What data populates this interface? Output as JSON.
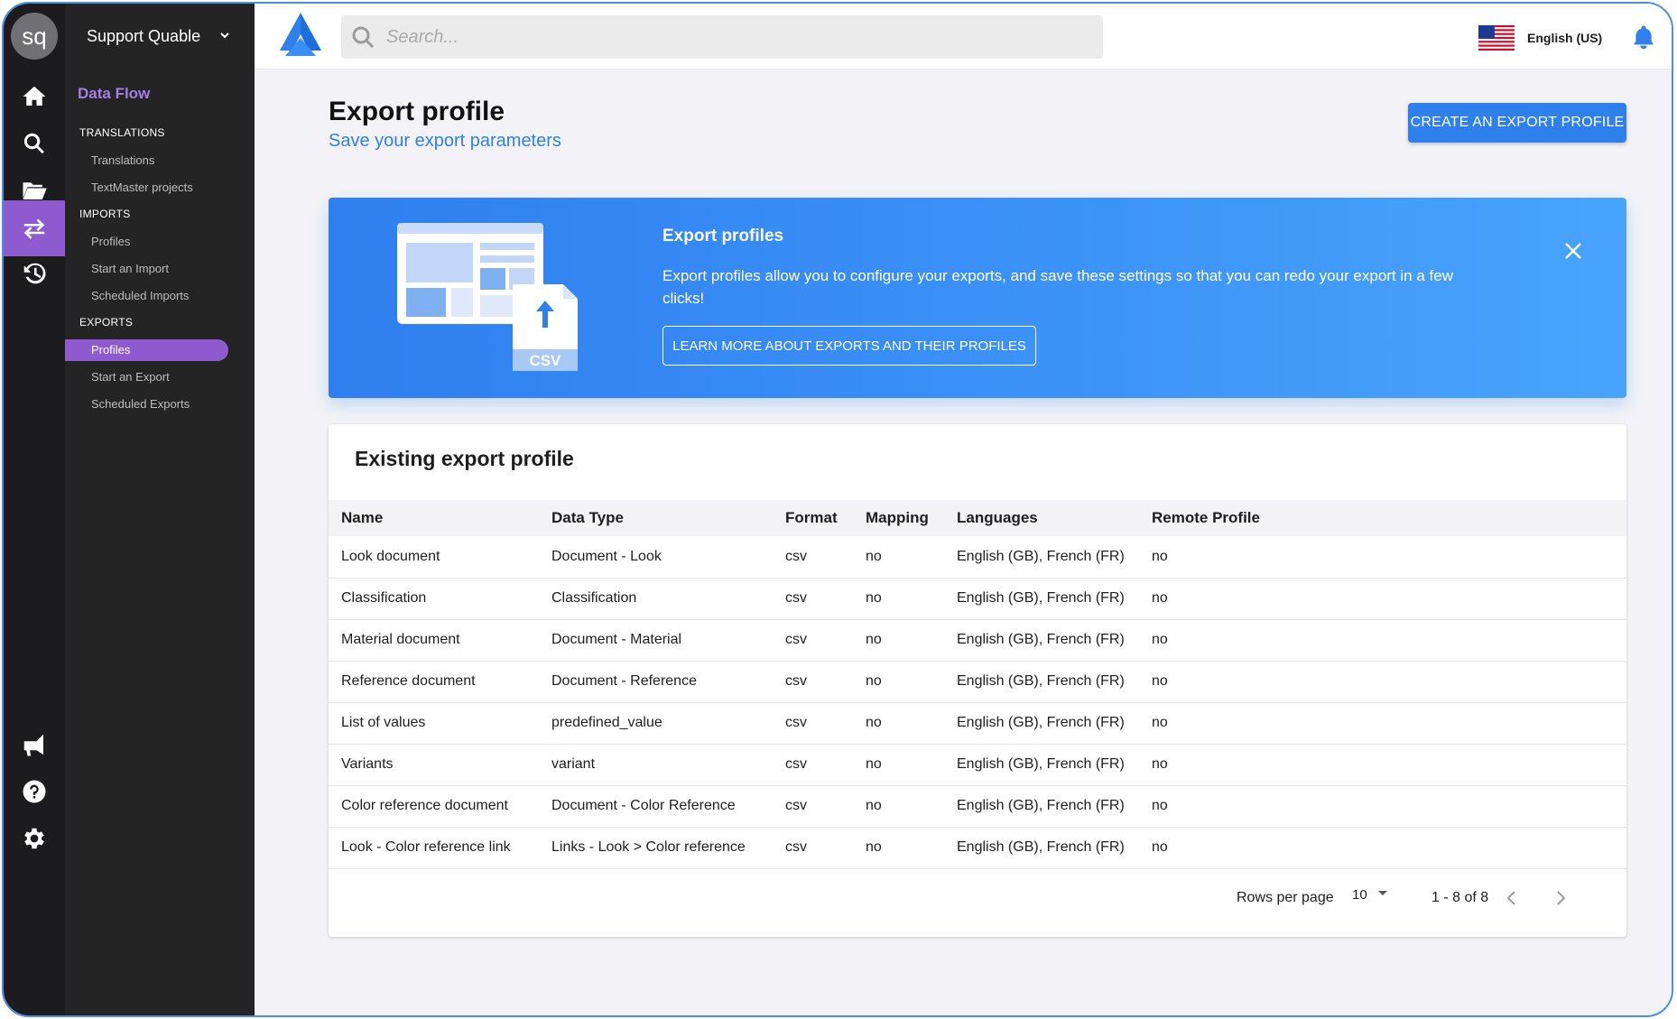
{
  "user": {
    "initials": "sq",
    "org": "Support Quable"
  },
  "nav": {
    "section": "Data Flow",
    "groups": [
      {
        "label": "TRANSLATIONS",
        "items": [
          "Translations",
          "TextMaster projects"
        ]
      },
      {
        "label": "IMPORTS",
        "items": [
          "Profiles",
          "Start an Import",
          "Scheduled Imports"
        ]
      },
      {
        "label": "EXPORTS",
        "items": [
          "Profiles",
          "Start an Export",
          "Scheduled Exports"
        ]
      }
    ]
  },
  "rail_icons": [
    "home-icon",
    "search-icon",
    "folder-open-icon",
    "transfer-icon",
    "history-icon",
    "megaphone-icon",
    "help-icon",
    "gear-icon"
  ],
  "search": {
    "placeholder": "Search..."
  },
  "language": "English (US)",
  "page": {
    "title": "Export profile",
    "subtitle": "Save your export parameters",
    "create_button": "CREATE AN EXPORT PROFILE"
  },
  "banner": {
    "title": "Export profiles",
    "text": "Export profiles allow you to configure your exports, and save these settings so that you can redo your export in a few clicks!",
    "button": "LEARN MORE ABOUT EXPORTS AND THEIR PROFILES",
    "illustration_label": "CSV"
  },
  "table": {
    "title": "Existing export profile",
    "columns": [
      "Name",
      "Data Type",
      "Format",
      "Mapping",
      "Languages",
      "Remote Profile"
    ],
    "rows": [
      [
        "Look document",
        "Document - Look",
        "csv",
        "no",
        "English (GB), French (FR)",
        "no"
      ],
      [
        "Classification",
        "Classification",
        "csv",
        "no",
        "English (GB), French (FR)",
        "no"
      ],
      [
        "Material document",
        "Document - Material",
        "csv",
        "no",
        "English (GB), French (FR)",
        "no"
      ],
      [
        "Reference document",
        "Document - Reference",
        "csv",
        "no",
        "English (GB), French (FR)",
        "no"
      ],
      [
        "List of values",
        "predefined_value",
        "csv",
        "no",
        "English (GB), French (FR)",
        "no"
      ],
      [
        "Variants",
        "variant",
        "csv",
        "no",
        "English (GB), French (FR)",
        "no"
      ],
      [
        "Color reference document",
        "Document - Color Reference",
        "csv",
        "no",
        "English (GB), French (FR)",
        "no"
      ],
      [
        "Look - Color reference link",
        "Links - Look > Color reference",
        "csv",
        "no",
        "English (GB), French (FR)",
        "no"
      ]
    ],
    "pagination": {
      "rows_per_page_label": "Rows per page",
      "rows_per_page": "10",
      "range": "1 - 8 of 8"
    }
  },
  "colors": {
    "accent": "#2f80ed",
    "nav_active": "#8d5bcf",
    "rail_bg": "#1c1c1e",
    "subnav_bg": "#242424"
  }
}
